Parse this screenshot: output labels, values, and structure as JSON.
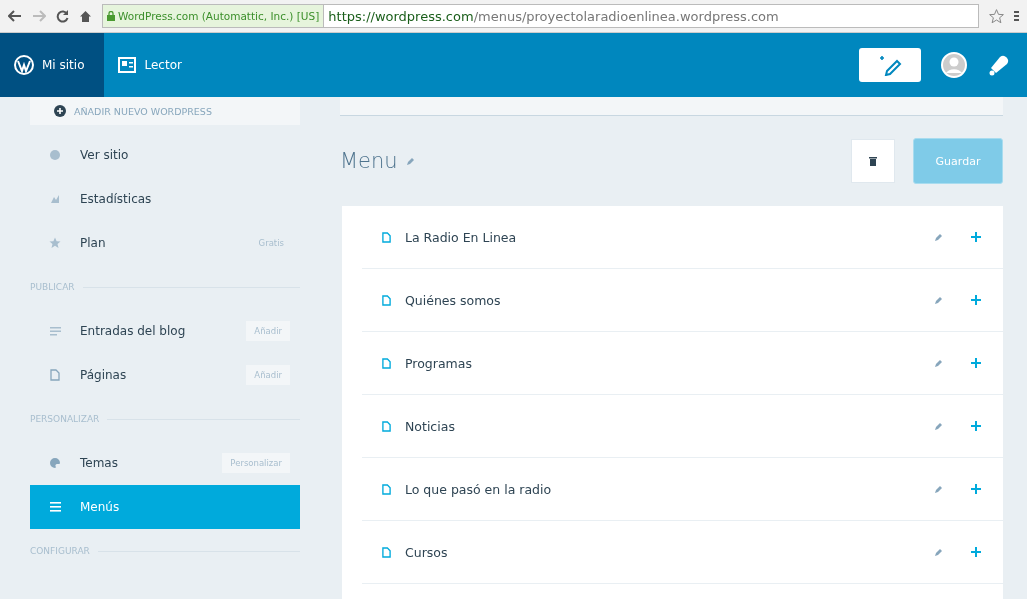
{
  "browser": {
    "identity": "WordPress.com (Automattic, Inc.) [US]",
    "url_host": "https://wordpress.com",
    "url_path": "/menus/proyectolaradioenlinea.wordpress.com"
  },
  "masterbar": {
    "tabs": [
      {
        "label": "Mi sitio",
        "selected": true
      },
      {
        "label": "Lector",
        "selected": false
      }
    ]
  },
  "sidebar": {
    "add_site": "AÑADIR NUEVO WORDPRESS",
    "entries": [
      {
        "kind": "item",
        "label": "Ver sitio",
        "selected": false
      },
      {
        "kind": "item",
        "label": "Estadísticas",
        "selected": false
      },
      {
        "kind": "item",
        "label": "Plan",
        "selected": false,
        "badge": "Gratis"
      },
      {
        "kind": "section",
        "label": "PUBLICAR"
      },
      {
        "kind": "item",
        "label": "Entradas del blog",
        "selected": false,
        "action": "Añadir"
      },
      {
        "kind": "item",
        "label": "Páginas",
        "selected": false,
        "action": "Añadir"
      },
      {
        "kind": "section",
        "label": "PERSONALIZAR"
      },
      {
        "kind": "item",
        "label": "Temas",
        "selected": false,
        "action": "Personalizar"
      },
      {
        "kind": "item",
        "label": "Menús",
        "selected": true
      },
      {
        "kind": "section",
        "label": "CONFIGURAR"
      }
    ]
  },
  "menu": {
    "title": "Menu",
    "save_button": {
      "label": "Guardar",
      "disabled": true
    },
    "items": [
      {
        "label": "La Radio En Linea"
      },
      {
        "label": "Quiénes somos"
      },
      {
        "label": "Programas"
      },
      {
        "label": "Noticias"
      },
      {
        "label": "Lo que pasó en la radio"
      },
      {
        "label": "Cursos"
      }
    ]
  }
}
